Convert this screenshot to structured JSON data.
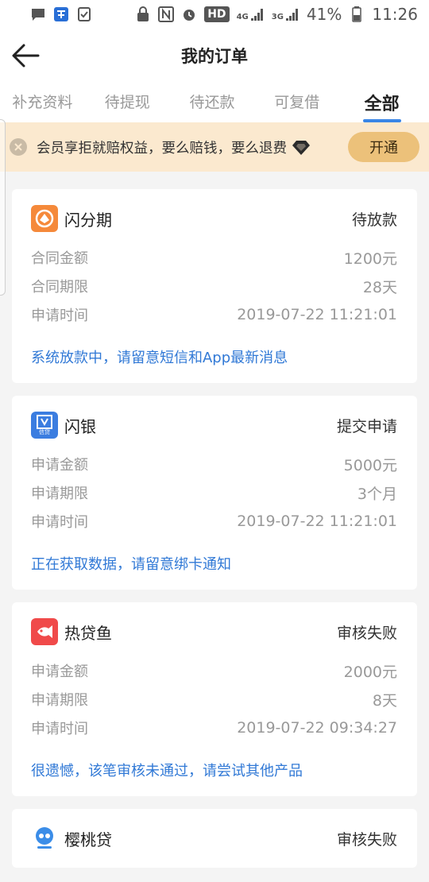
{
  "status_bar": {
    "net_4g": "4G",
    "net_3g": "3G",
    "hd": "HD",
    "battery": "41%",
    "time": "11:26"
  },
  "header": {
    "title": "我的订单"
  },
  "tabs": [
    {
      "label": "补充资料",
      "active": false
    },
    {
      "label": "待提现",
      "active": false
    },
    {
      "label": "待还款",
      "active": false
    },
    {
      "label": "可复借",
      "active": false
    },
    {
      "label": "全部",
      "active": true
    }
  ],
  "promo": {
    "text": "会员享拒就赔权益，要么赔钱，要么退费",
    "button": "开通"
  },
  "orders": [
    {
      "name": "闪分期",
      "status": "待放款",
      "logo_color": "#f5893a",
      "rows": [
        {
          "label": "合同金额",
          "value": "1200元"
        },
        {
          "label": "合同期限",
          "value": "28天"
        },
        {
          "label": "申请时间",
          "value": "2019-07-22 11:21:01"
        }
      ],
      "message": "系统放款中，请留意短信和App最新消息"
    },
    {
      "name": "闪银",
      "status": "提交申请",
      "logo_color": "#3b7de0",
      "logo_text": "信贷",
      "rows": [
        {
          "label": "申请金额",
          "value": "5000元"
        },
        {
          "label": "申请期限",
          "value": "3个月"
        },
        {
          "label": "申请时间",
          "value": "2019-07-22 11:21:01"
        }
      ],
      "message": "正在获取数据，请留意绑卡通知"
    },
    {
      "name": "热贷鱼",
      "status": "审核失败",
      "logo_color": "#f04a4a",
      "rows": [
        {
          "label": "申请金额",
          "value": "2000元"
        },
        {
          "label": "申请期限",
          "value": "8天"
        },
        {
          "label": "申请时间",
          "value": "2019-07-22 09:34:27"
        }
      ],
      "message": "很遗憾，该笔审核未通过，请尝试其他产品"
    },
    {
      "name": "樱桃贷",
      "status": "审核失败",
      "logo_color": "#3b8de8"
    }
  ],
  "colors": {
    "accent": "#3a86e6",
    "link": "#3179d6",
    "promo_bg": "#fbe9cf",
    "promo_button": "#ecc17a"
  }
}
